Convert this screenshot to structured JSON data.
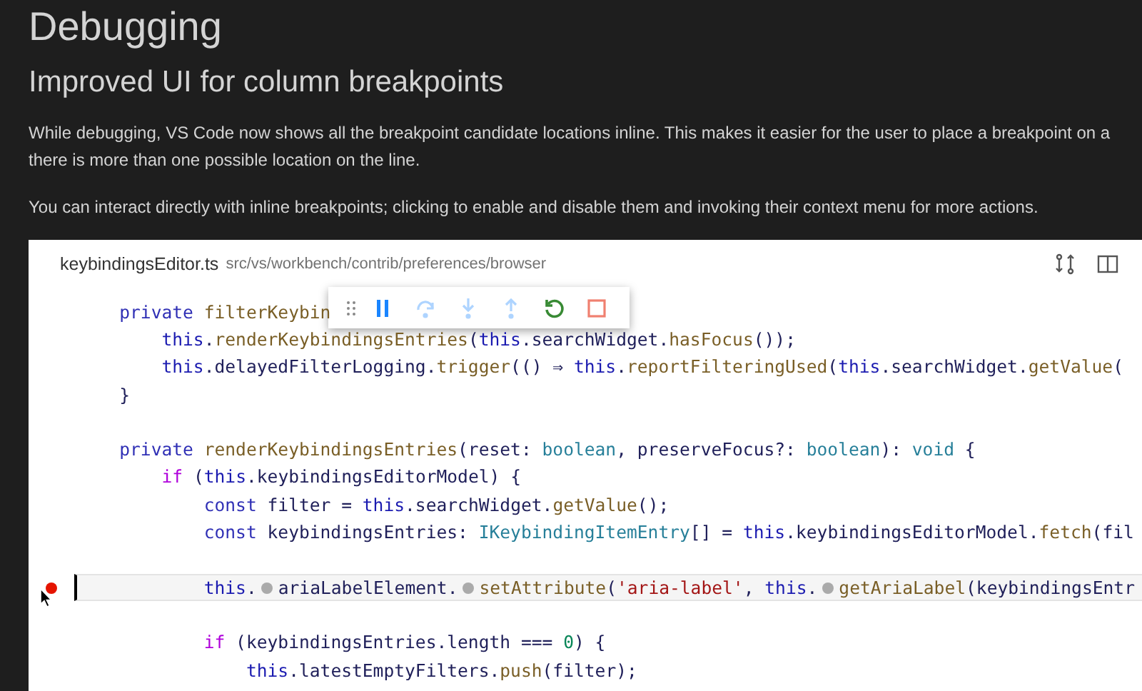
{
  "heading": "Debugging",
  "subheading": "Improved UI for column breakpoints",
  "paragraphs": [
    {
      "lines": [
        "While debugging, VS Code now shows all the breakpoint candidate locations inline. This makes it easier for the user to place a breakpoint on a",
        "there is more than one possible location on the line."
      ]
    },
    {
      "lines": [
        "You can interact directly with inline breakpoints; clicking to enable and disable them and invoking their context menu for more actions."
      ]
    }
  ],
  "editor": {
    "file_name": "keybindingsEditor.ts",
    "path": "src/vs/workbench/contrib/preferences/browser",
    "debug_toolbar": [
      {
        "kind": "grip"
      },
      {
        "kind": "pause",
        "disabled": false
      },
      {
        "kind": "step-over",
        "disabled": true
      },
      {
        "kind": "step-into",
        "disabled": true
      },
      {
        "kind": "step-out",
        "disabled": true
      },
      {
        "kind": "restart",
        "disabled": false
      },
      {
        "kind": "stop",
        "disabled": false
      }
    ],
    "lines": [
      {
        "breakpoint": false,
        "highlighted": false,
        "tokens": [
          {
            "kind": "keyword",
            "text": "    private "
          },
          {
            "kind": "function",
            "text": "filterKeybin"
          }
        ]
      },
      {
        "breakpoint": false,
        "highlighted": false,
        "tokens": [
          {
            "kind": "this",
            "text": "        this"
          },
          {
            "kind": "plain",
            "text": "."
          },
          {
            "kind": "function",
            "text": "renderKeybindingsEntries"
          },
          {
            "kind": "plain",
            "text": "("
          },
          {
            "kind": "this",
            "text": "this"
          },
          {
            "kind": "plain",
            "text": ".searchWidget."
          },
          {
            "kind": "function",
            "text": "hasFocus"
          },
          {
            "kind": "plain",
            "text": "());"
          }
        ]
      },
      {
        "breakpoint": false,
        "highlighted": false,
        "tokens": [
          {
            "kind": "this",
            "text": "        this"
          },
          {
            "kind": "plain",
            "text": ".delayedFilterLogging."
          },
          {
            "kind": "function",
            "text": "trigger"
          },
          {
            "kind": "plain",
            "text": "(() ⇒ "
          },
          {
            "kind": "this",
            "text": "this"
          },
          {
            "kind": "plain",
            "text": "."
          },
          {
            "kind": "function",
            "text": "reportFilteringUsed"
          },
          {
            "kind": "plain",
            "text": "("
          },
          {
            "kind": "this",
            "text": "this"
          },
          {
            "kind": "plain",
            "text": ".searchWidget."
          },
          {
            "kind": "function",
            "text": "getValue"
          },
          {
            "kind": "plain",
            "text": "("
          }
        ]
      },
      {
        "breakpoint": false,
        "highlighted": false,
        "tokens": [
          {
            "kind": "plain",
            "text": "    }"
          }
        ]
      },
      {
        "breakpoint": false,
        "highlighted": false
      },
      {
        "breakpoint": false,
        "highlighted": false,
        "tokens": [
          {
            "kind": "keyword",
            "text": "    private "
          },
          {
            "kind": "function",
            "text": "renderKeybindingsEntries"
          },
          {
            "kind": "plain",
            "text": "(reset: "
          },
          {
            "kind": "type",
            "text": "boolean"
          },
          {
            "kind": "plain",
            "text": ", preserveFocus?: "
          },
          {
            "kind": "type",
            "text": "boolean"
          },
          {
            "kind": "plain",
            "text": "): "
          },
          {
            "kind": "type",
            "text": "void"
          },
          {
            "kind": "plain",
            "text": " {"
          }
        ]
      },
      {
        "breakpoint": false,
        "highlighted": false,
        "tokens": [
          {
            "kind": "control",
            "text": "        if"
          },
          {
            "kind": "plain",
            "text": " ("
          },
          {
            "kind": "this",
            "text": "this"
          },
          {
            "kind": "plain",
            "text": ".keybindingsEditorModel) {"
          }
        ]
      },
      {
        "breakpoint": false,
        "highlighted": false,
        "tokens": [
          {
            "kind": "keyword",
            "text": "            const"
          },
          {
            "kind": "plain",
            "text": " filter = "
          },
          {
            "kind": "this",
            "text": "this"
          },
          {
            "kind": "plain",
            "text": ".searchWidget."
          },
          {
            "kind": "function",
            "text": "getValue"
          },
          {
            "kind": "plain",
            "text": "();"
          }
        ]
      },
      {
        "breakpoint": false,
        "highlighted": false,
        "tokens": [
          {
            "kind": "keyword",
            "text": "            const"
          },
          {
            "kind": "plain",
            "text": " keybindingsEntries: "
          },
          {
            "kind": "type",
            "text": "IKeybindingItemEntry"
          },
          {
            "kind": "plain",
            "text": "[] = "
          },
          {
            "kind": "this",
            "text": "this"
          },
          {
            "kind": "plain",
            "text": ".keybindingsEditorModel."
          },
          {
            "kind": "function",
            "text": "fetch"
          },
          {
            "kind": "plain",
            "text": "(fil"
          }
        ]
      },
      {
        "breakpoint": false,
        "highlighted": false
      },
      {
        "breakpoint": true,
        "highlighted": true,
        "tokens": [
          {
            "kind": "this",
            "text": "            this"
          },
          {
            "kind": "plain",
            "text": "."
          },
          {
            "kind": "dot"
          },
          {
            "kind": "plain",
            "text": "ariaLabelElement."
          },
          {
            "kind": "dot"
          },
          {
            "kind": "function",
            "text": "setAttribute"
          },
          {
            "kind": "plain",
            "text": "("
          },
          {
            "kind": "string",
            "text": "'aria-label'"
          },
          {
            "kind": "plain",
            "text": ", "
          },
          {
            "kind": "this",
            "text": "this"
          },
          {
            "kind": "plain",
            "text": "."
          },
          {
            "kind": "dot"
          },
          {
            "kind": "function",
            "text": "getAriaLabel"
          },
          {
            "kind": "plain",
            "text": "(keybindingsEntr"
          }
        ]
      },
      {
        "breakpoint": false,
        "highlighted": false
      },
      {
        "breakpoint": false,
        "highlighted": false,
        "tokens": [
          {
            "kind": "control",
            "text": "            if"
          },
          {
            "kind": "plain",
            "text": " (keybindingsEntries.length === "
          },
          {
            "kind": "number",
            "text": "0"
          },
          {
            "kind": "plain",
            "text": ") {"
          }
        ]
      },
      {
        "breakpoint": false,
        "highlighted": false,
        "tokens": [
          {
            "kind": "this",
            "text": "                this"
          },
          {
            "kind": "plain",
            "text": ".latestEmptyFilters."
          },
          {
            "kind": "function",
            "text": "push"
          },
          {
            "kind": "plain",
            "text": "(filter);"
          }
        ]
      }
    ]
  }
}
